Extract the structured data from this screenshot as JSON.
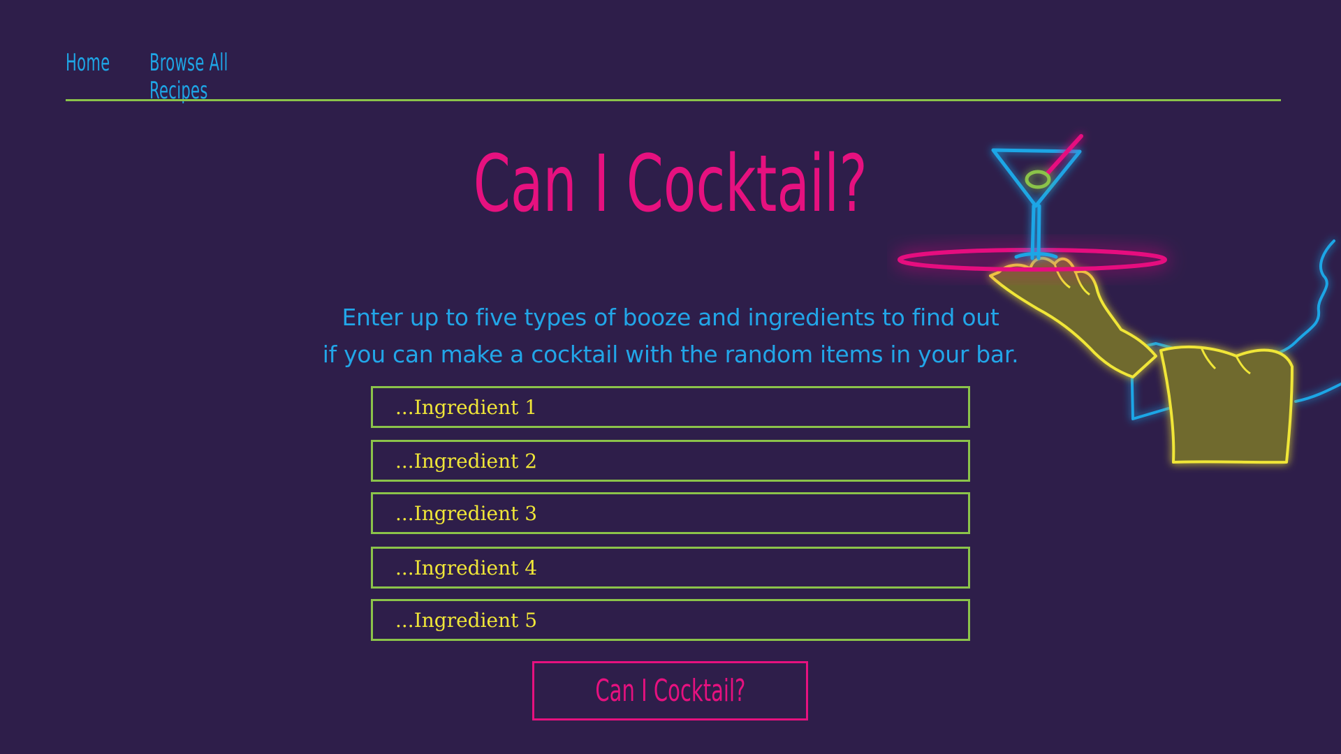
{
  "nav": {
    "home_label": "Home",
    "browse_label": "Browse All Recipes"
  },
  "main": {
    "title": "Can I Cocktail?",
    "subtitle_line1": "Enter up to five types of booze and ingredients to find out",
    "subtitle_line2": "if you can make a cocktail with the random items in your bar.",
    "ingredient_placeholders": [
      "...Ingredient 1",
      "...Ingredient 2",
      "...Ingredient 3",
      "...Ingredient 4",
      "...Ingredient 5"
    ],
    "submit_label": "Can I Cocktail?"
  },
  "illustration": {
    "icon": "neon-waiter-martini-icon"
  },
  "colors": {
    "background": "#2e1e4a",
    "accent_pink": "#e6117f",
    "accent_blue": "#22a6e8",
    "accent_green": "#8bc34a",
    "accent_yellow": "#f0e638"
  }
}
